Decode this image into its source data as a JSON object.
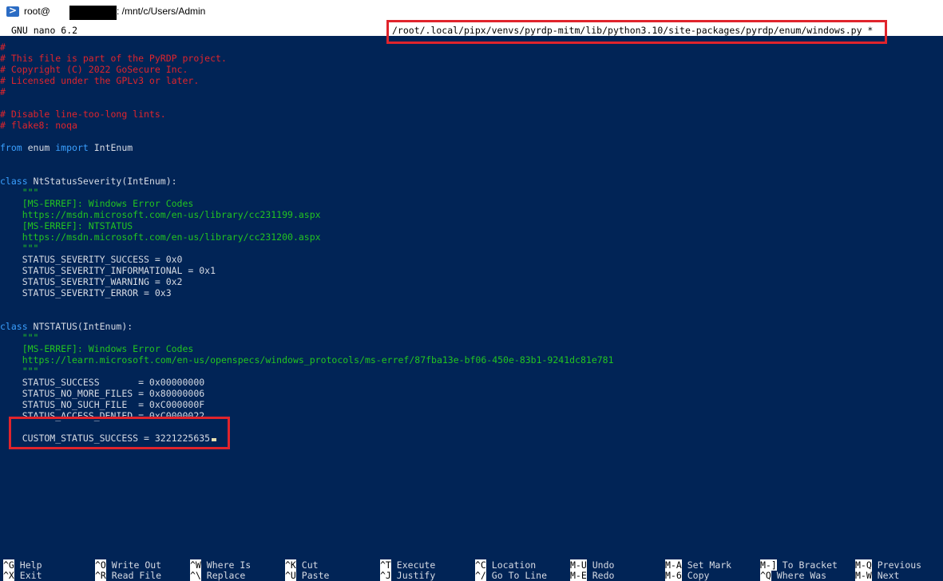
{
  "window": {
    "title_user": "root@",
    "title_path": ": /mnt/c/Users/Admin"
  },
  "nano": {
    "version": "GNU nano 6.2",
    "filename": "/root/.local/pipx/venvs/pyrdp-mitm/lib/python3.10/site-packages/pyrdp/enum/windows.py *"
  },
  "code_lines": [
    {
      "text": "#",
      "type": "comment"
    },
    {
      "text": "# This file is part of the PyRDP project.",
      "type": "comment"
    },
    {
      "text": "# Copyright (C) 2022 GoSecure Inc.",
      "type": "comment"
    },
    {
      "text": "# Licensed under the GPLv3 or later.",
      "type": "comment"
    },
    {
      "text": "#",
      "type": "comment"
    },
    {
      "text": "",
      "type": "text"
    },
    {
      "text": "# Disable line-too-long lints.",
      "type": "comment"
    },
    {
      "text": "# flake8: noqa",
      "type": "comment"
    },
    {
      "text": "",
      "type": "text"
    },
    {
      "text": "from enum import IntEnum",
      "type": "import"
    },
    {
      "text": "",
      "type": "text"
    },
    {
      "text": "",
      "type": "text"
    },
    {
      "text": "class NtStatusSeverity(IntEnum):",
      "type": "class"
    },
    {
      "text": "    \"\"\"",
      "type": "doc"
    },
    {
      "text": "    [MS-ERREF]: Windows Error Codes",
      "type": "doc"
    },
    {
      "text": "    https://msdn.microsoft.com/en-us/library/cc231199.aspx",
      "type": "doc"
    },
    {
      "text": "    [MS-ERREF]: NTSTATUS",
      "type": "doc"
    },
    {
      "text": "    https://msdn.microsoft.com/en-us/library/cc231200.aspx",
      "type": "doc"
    },
    {
      "text": "    \"\"\"",
      "type": "doc"
    },
    {
      "text": "    STATUS_SEVERITY_SUCCESS = 0x0",
      "type": "text"
    },
    {
      "text": "    STATUS_SEVERITY_INFORMATIONAL = 0x1",
      "type": "text"
    },
    {
      "text": "    STATUS_SEVERITY_WARNING = 0x2",
      "type": "text"
    },
    {
      "text": "    STATUS_SEVERITY_ERROR = 0x3",
      "type": "text"
    },
    {
      "text": "",
      "type": "text"
    },
    {
      "text": "",
      "type": "text"
    },
    {
      "text": "class NTSTATUS(IntEnum):",
      "type": "class"
    },
    {
      "text": "    \"\"\"",
      "type": "doc"
    },
    {
      "text": "    [MS-ERREF]: Windows Error Codes",
      "type": "doc"
    },
    {
      "text": "    https://learn.microsoft.com/en-us/openspecs/windows_protocols/ms-erref/87fba13e-bf06-450e-83b1-9241dc81e781",
      "type": "doc"
    },
    {
      "text": "    \"\"\"",
      "type": "doc"
    },
    {
      "text": "    STATUS_SUCCESS       = 0x00000000",
      "type": "text"
    },
    {
      "text": "    STATUS_NO_MORE_FILES = 0x80000006",
      "type": "text"
    },
    {
      "text": "    STATUS_NO_SUCH_FILE  = 0xC000000F",
      "type": "text"
    },
    {
      "text": "    STATUS_ACCESS_DENIED = 0xC0000022",
      "type": "text"
    },
    {
      "text": "",
      "type": "text"
    },
    {
      "text": "    CUSTOM_STATUS_SUCCESS = 3221225635",
      "type": "text"
    }
  ],
  "shortcuts": [
    {
      "key1": "^G",
      "label1": "Help",
      "key2": "^X",
      "label2": "Exit"
    },
    {
      "key1": "^O",
      "label1": "Write Out",
      "key2": "^R",
      "label2": "Read File"
    },
    {
      "key1": "^W",
      "label1": "Where Is",
      "key2": "^\\",
      "label2": "Replace"
    },
    {
      "key1": "^K",
      "label1": "Cut",
      "key2": "^U",
      "label2": "Paste"
    },
    {
      "key1": "^T",
      "label1": "Execute",
      "key2": "^J",
      "label2": "Justify"
    },
    {
      "key1": "^C",
      "label1": "Location",
      "key2": "^/",
      "label2": "Go To Line"
    },
    {
      "key1": "M-U",
      "label1": "Undo",
      "key2": "M-E",
      "label2": "Redo"
    },
    {
      "key1": "M-A",
      "label1": "Set Mark",
      "key2": "M-6",
      "label2": "Copy"
    },
    {
      "key1": "M-]",
      "label1": "To Bracket",
      "key2": "^Q",
      "label2": "Where Was"
    },
    {
      "key1": "M-Q",
      "label1": "Previous",
      "key2": "M-W",
      "label2": "Next"
    }
  ],
  "colors": {
    "background": "#012456",
    "comment": "#e0242c",
    "keyword": "#3aa0ff",
    "docstring": "#23c420",
    "highlight_box": "#e0242c"
  }
}
